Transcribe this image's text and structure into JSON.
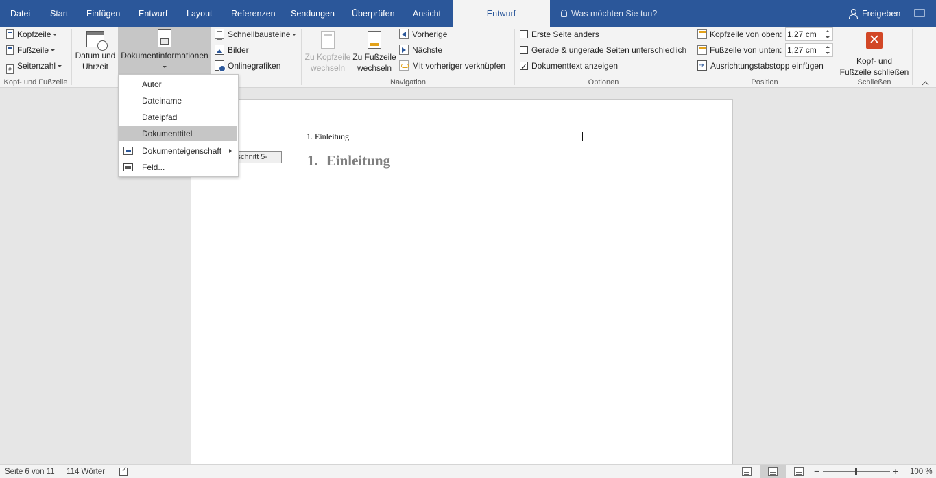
{
  "menu": {
    "tabs": [
      "Datei",
      "Start",
      "Einfügen",
      "Entwurf",
      "Layout",
      "Referenzen",
      "Sendungen",
      "Überprüfen",
      "Ansicht"
    ],
    "active_tab": "Entwurf",
    "tell_me": "Was möchten Sie tun?",
    "share": "Freigeben"
  },
  "ribbon": {
    "hf_group": {
      "label": "Kopf- und Fußzeile",
      "header": "Kopfzeile",
      "footer": "Fußzeile",
      "page_number": "Seitenzahl",
      "page_number_icon": "#"
    },
    "insert_group": {
      "date_time_line1": "Datum und",
      "date_time_line2": "Uhrzeit",
      "doc_info": "Dokumentinformationen",
      "quick_parts": "Schnellbausteine",
      "pictures": "Bilder",
      "online_pictures": "Onlinegrafiken"
    },
    "nav_group": {
      "label": "Navigation",
      "goto_header_line1": "Zu Kopfzeile",
      "goto_header_line2": "wechseln",
      "goto_footer_line1": "Zu Fußzeile",
      "goto_footer_line2": "wechseln",
      "previous": "Vorherige",
      "next": "Nächste",
      "link_previous": "Mit vorheriger verknüpfen"
    },
    "options_group": {
      "label": "Optionen",
      "first_page": "Erste Seite anders",
      "first_page_checked": false,
      "odd_even": "Gerade & ungerade Seiten unterschiedlich",
      "odd_even_checked": false,
      "show_doc_text": "Dokumenttext anzeigen",
      "show_doc_text_checked": true
    },
    "position_group": {
      "label": "Position",
      "header_from_top": "Kopfzeile von oben:",
      "header_from_top_value": "1,27 cm",
      "footer_from_bottom": "Fußzeile von unten:",
      "footer_from_bottom_value": "1,27 cm",
      "insert_align_tab": "Ausrichtungstabstopp einfügen"
    },
    "close_group": {
      "label": "Schließen",
      "close_line1": "Kopf- und",
      "close_line2": "Fußzeile schließen",
      "close_glyph": "✕"
    }
  },
  "dropdown": {
    "items": [
      "Autor",
      "Dateiname",
      "Dateipfad",
      "Dokumenttitel",
      "Dokumenteigenschaft",
      "Feld..."
    ],
    "highlighted": "Dokumenttitel"
  },
  "document": {
    "header_text": "1. Einleitung",
    "section_tag": "Abschnitt 5-",
    "heading_number": "1.",
    "heading_text": "Einleitung"
  },
  "status": {
    "page": "Seite 6 von 11",
    "words": "114 Wörter",
    "zoom": "100 %",
    "zoom_minus": "−",
    "zoom_plus": "+"
  },
  "colors": {
    "accent": "#2b579a",
    "close": "#d24726"
  }
}
